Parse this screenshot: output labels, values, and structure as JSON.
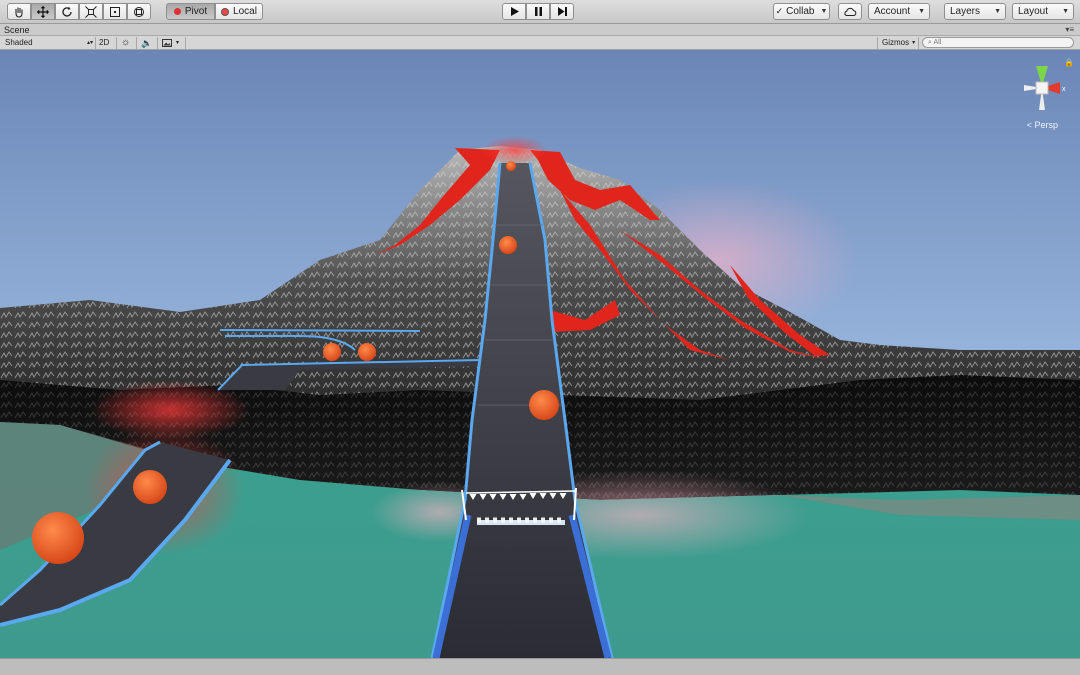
{
  "toolbar": {
    "tools": [
      {
        "name": "hand-tool",
        "active": false
      },
      {
        "name": "move-tool",
        "active": true
      },
      {
        "name": "rotate-tool",
        "active": false
      },
      {
        "name": "scale-tool",
        "active": false
      },
      {
        "name": "rect-tool",
        "active": false
      },
      {
        "name": "transform-tool",
        "active": false
      }
    ],
    "pivot_label": "Pivot",
    "local_label": "Local",
    "collab_label": "Collab",
    "account_label": "Account",
    "layers_label": "Layers",
    "layout_label": "Layout"
  },
  "scene": {
    "tab_title": "Scene",
    "shading_mode": "Shaded",
    "mode_2d": "2D",
    "gizmos_label": "Gizmos",
    "search_placeholder": "All",
    "projection_label": "Persp",
    "axis_x_label": "x"
  },
  "colors": {
    "accent_track": "#5aa8f0",
    "lava": "#e0261c",
    "water": "#3f9a8e",
    "sky_top": "#6b86b6",
    "sky_horizon": "#b7d2ee"
  }
}
